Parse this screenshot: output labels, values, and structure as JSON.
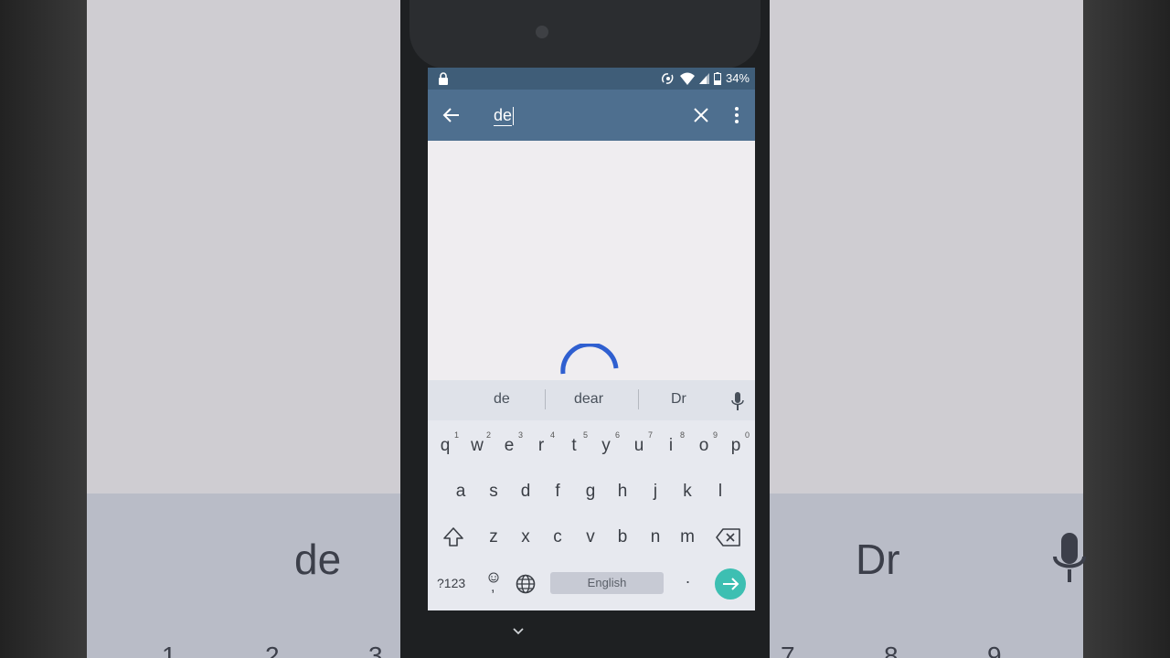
{
  "statusbar": {
    "battery": "34%"
  },
  "search": {
    "query": "de"
  },
  "suggestions": [
    "de",
    "dear",
    "Dr"
  ],
  "keyboard": {
    "row1": [
      {
        "k": "q",
        "h": "1"
      },
      {
        "k": "w",
        "h": "2"
      },
      {
        "k": "e",
        "h": "3"
      },
      {
        "k": "r",
        "h": "4"
      },
      {
        "k": "t",
        "h": "5"
      },
      {
        "k": "y",
        "h": "6"
      },
      {
        "k": "u",
        "h": "7"
      },
      {
        "k": "i",
        "h": "8"
      },
      {
        "k": "o",
        "h": "9"
      },
      {
        "k": "p",
        "h": "0"
      }
    ],
    "row2": [
      "a",
      "s",
      "d",
      "f",
      "g",
      "h",
      "j",
      "k",
      "l"
    ],
    "row3": [
      "z",
      "x",
      "c",
      "v",
      "b",
      "n",
      "m"
    ],
    "symbols_label": "?123",
    "space_label": "English",
    "period": ".",
    "emoji_comma": ","
  },
  "background": {
    "left_word": "de",
    "right_word": "Dr",
    "left_digits": [
      "1",
      "2",
      "3"
    ],
    "right_digits": [
      "7",
      "8",
      "9"
    ]
  },
  "colors": {
    "appbar": "#4e6f8f",
    "statusbar": "#3f5d78",
    "spinner": "#2f5fd0",
    "go_button": "#3dbfb2"
  }
}
